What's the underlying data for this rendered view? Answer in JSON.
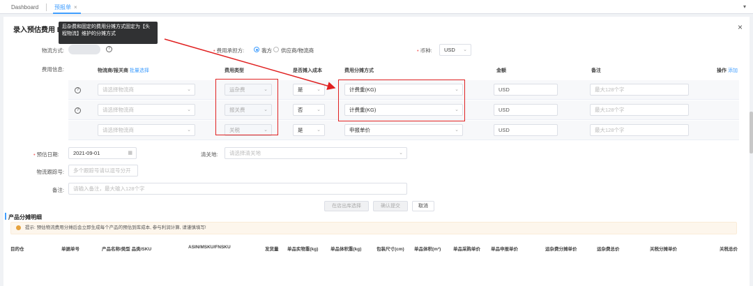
{
  "tabs": [
    {
      "label": "Dashboard"
    },
    {
      "label": "预报单",
      "close": "×"
    }
  ],
  "corner_icon": "▾",
  "dialog": {
    "title": "录入预估费用 DL",
    "close": "×",
    "tooltip": "后杂费和固定的费用分摊方式固定为【头程物流】维护的分摊方式"
  },
  "form": {
    "logistics_label": "物流方式:",
    "help_icon": "?",
    "payer_label": "费用承担方:",
    "payer_options": [
      "我方",
      "供应商/物流商"
    ],
    "currency_label": "币种:",
    "currency_value": "USD",
    "fee_info_label": "费用信息:"
  },
  "table": {
    "headers": {
      "carrier": "物流商/报关商",
      "batch_select": "批量选择",
      "fee_type": "费用类型",
      "include_cost": "是否摊入成本",
      "alloc_method": "费用分摊方式",
      "amount": "金额",
      "remark": "备注",
      "ops": "操作",
      "add": "添加"
    },
    "rows": [
      {
        "help": "?",
        "carrier_ph": "请选择物流商",
        "fee_type": "运杂费",
        "include": "是",
        "method": "计费重(KG)",
        "amount_ph": "USD",
        "remark_ph": "最大128个字"
      },
      {
        "help": "?",
        "carrier_ph": "请选择物流商",
        "fee_type": "报关费",
        "include": "否",
        "method": "计费重(KG)",
        "amount_ph": "USD",
        "remark_ph": "最大128个字"
      },
      {
        "help": "",
        "carrier_ph": "请选择物流商",
        "fee_type": "关税",
        "include": "是",
        "method": "申报单价",
        "amount_ph": "USD",
        "remark_ph": "最大128个字"
      }
    ]
  },
  "lower": {
    "date_label": "预估日期:",
    "date_value": "2021-09-01",
    "customs_label": "清关地:",
    "customs_ph": "请选择清关地",
    "tracking_label": "物流跟踪号:",
    "tracking_ph": "多个跟踪号请以逗号分开",
    "remark_label": "备注:",
    "remark_ph": "请输入备注，最大输入128个字",
    "btn_confirm_upload": "在店出库选择",
    "btn_confirm": "确认提交",
    "btn_cancel": "取消"
  },
  "product_section": {
    "title": "产品分摊明细",
    "warning": "提示: 预估物流费用分摊后会立即生成每个产品的预估到库成本, 参与利润计算, 请谨慎填写!",
    "columns": [
      "目的仓",
      "单据单号",
      "产品名称/类型 品类/SKU",
      "ASIN/MSKU/FNSKU",
      "发货量",
      "单品实物重(kg)",
      "单品体积重(kg)",
      "包装尺寸(cm)",
      "单品体积(m³)",
      "单品采购单价",
      "单品申报单价",
      "运杂费分摊单价",
      "运杂费总价",
      "关税分摊单价",
      "关税总价"
    ]
  },
  "colors": {
    "accent": "#409eff",
    "annotation": "#e02020"
  }
}
